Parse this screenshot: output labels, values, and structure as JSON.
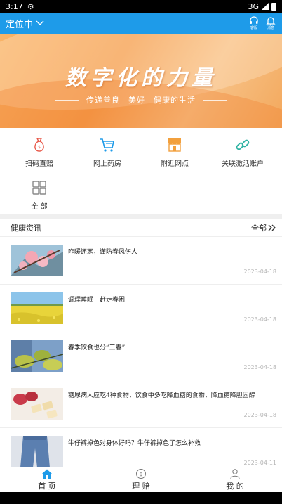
{
  "status_bar": {
    "time": "3:17",
    "network": "3G"
  },
  "header": {
    "location_label": "定位中",
    "actions": [
      {
        "icon": "headset-icon",
        "label": "客服"
      },
      {
        "icon": "bell-icon",
        "label": "消息"
      }
    ]
  },
  "banner": {
    "title": "数字化的力量",
    "subtitle": "传递善良　美好　健康的生活"
  },
  "quick_menu": [
    {
      "icon": "money-bag-icon",
      "label": "扫码直赔",
      "color": "#e8594a"
    },
    {
      "icon": "shopping-cart-icon",
      "label": "网上药房",
      "color": "#1e9be9"
    },
    {
      "icon": "store-icon",
      "label": "附近网点",
      "color": "#f2a03d"
    },
    {
      "icon": "link-icon",
      "label": "关联激活账户",
      "color": "#2fb3a3"
    },
    {
      "icon": "grid-icon",
      "label": "全 部",
      "color": "#888888"
    }
  ],
  "news": {
    "section_title": "健康资讯",
    "all_label": "全部",
    "items": [
      {
        "title": "咋暖还寒，谨防春风伤人",
        "date": "2023-04-18",
        "image": "blossom-image"
      },
      {
        "title": "调理睡眠　赶走春困",
        "date": "2023-04-18",
        "image": "flower-field-image"
      },
      {
        "title": "春季饮食也分“三春”",
        "date": "2023-04-18",
        "image": "spring-leaves-image"
      },
      {
        "title": "糖尿病人应吃4种食物，饮食中多吃降血糖的食物，降血糖降胆固醇",
        "date": "2023-04-18",
        "image": "food-image"
      },
      {
        "title": "牛仔裤掉色对身体好吗？牛仔裤掉色了怎么补救",
        "date": "2023-04-11",
        "image": "jeans-image"
      }
    ]
  },
  "tab_bar": [
    {
      "icon": "home-icon",
      "label": "首 页",
      "active": true
    },
    {
      "icon": "claim-icon",
      "label": "理 赔",
      "active": false
    },
    {
      "icon": "user-icon",
      "label": "我 的",
      "active": false
    }
  ],
  "colors": {
    "primary": "#1e9be9",
    "banner": "#f59b4a"
  }
}
